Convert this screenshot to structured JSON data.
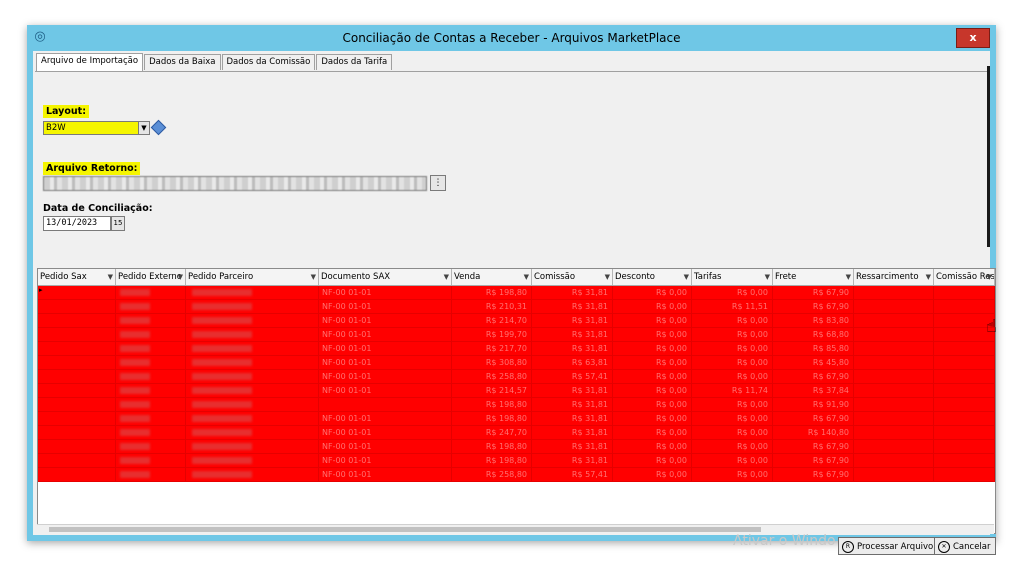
{
  "window": {
    "title": "Conciliação de Contas a Receber - Arquivos MarketPlace",
    "close_label": "x"
  },
  "tabs": [
    {
      "label": "Arquivo de Importação",
      "active": true
    },
    {
      "label": "Dados da Baixa",
      "active": false
    },
    {
      "label": "Dados da Comissão",
      "active": false
    },
    {
      "label": "Dados da Tarifa",
      "active": false
    }
  ],
  "form": {
    "layout_label": "Layout:",
    "layout_value": "B2W",
    "arquivo_label": "Arquivo Retorno:",
    "data_label": "Data de Conciliação:",
    "data_value": "13/01/2023",
    "cal_icon_text": "15"
  },
  "grid": {
    "columns": [
      {
        "label": "Pedido Sax"
      },
      {
        "label": "Pedido Externo"
      },
      {
        "label": "Pedido Parceiro"
      },
      {
        "label": "Documento SAX"
      },
      {
        "label": "Venda"
      },
      {
        "label": "Comissão"
      },
      {
        "label": "Desconto"
      },
      {
        "label": "Tarifas"
      },
      {
        "label": "Frete"
      },
      {
        "label": "Ressarcimento"
      },
      {
        "label": "Comissão Ress"
      }
    ],
    "rows": [
      {
        "documento": "NF-00    01-01",
        "venda": "R$ 198,80",
        "comissao": "R$ 31,81",
        "desconto": "R$ 0,00",
        "tarifas": "R$ 0,00",
        "frete": "R$ 67,90"
      },
      {
        "documento": "NF-00    01-01",
        "venda": "R$ 210,31",
        "comissao": "R$ 31,81",
        "desconto": "R$ 0,00",
        "tarifas": "R$ 11,51",
        "frete": "R$ 67,90"
      },
      {
        "documento": "NF-00    01-01",
        "venda": "R$ 214,70",
        "comissao": "R$ 31,81",
        "desconto": "R$ 0,00",
        "tarifas": "R$ 0,00",
        "frete": "R$ 83,80"
      },
      {
        "documento": "NF-00    01-01",
        "venda": "R$ 199,70",
        "comissao": "R$ 31,81",
        "desconto": "R$ 0,00",
        "tarifas": "R$ 0,00",
        "frete": "R$ 68,80"
      },
      {
        "documento": "NF-00    01-01",
        "venda": "R$ 217,70",
        "comissao": "R$ 31,81",
        "desconto": "R$ 0,00",
        "tarifas": "R$ 0,00",
        "frete": "R$ 85,80"
      },
      {
        "documento": "NF-00    01-01",
        "venda": "R$ 308,80",
        "comissao": "R$ 63,81",
        "desconto": "R$ 0,00",
        "tarifas": "R$ 0,00",
        "frete": "R$ 45,80"
      },
      {
        "documento": "NF-00    01-01",
        "venda": "R$ 258,80",
        "comissao": "R$ 57,41",
        "desconto": "R$ 0,00",
        "tarifas": "R$ 0,00",
        "frete": "R$ 67,90"
      },
      {
        "documento": "NF-00    01-01",
        "venda": "R$ 214,57",
        "comissao": "R$ 31,81",
        "desconto": "R$ 0,00",
        "tarifas": "R$ 11,74",
        "frete": "R$ 37,84"
      },
      {
        "documento": "",
        "venda": "R$ 198,80",
        "comissao": "R$ 31,81",
        "desconto": "R$ 0,00",
        "tarifas": "R$ 0,00",
        "frete": "R$ 91,90"
      },
      {
        "documento": "NF-00    01-01",
        "venda": "R$ 198,80",
        "comissao": "R$ 31,81",
        "desconto": "R$ 0,00",
        "tarifas": "R$ 0,00",
        "frete": "R$ 67,90"
      },
      {
        "documento": "NF-00    01-01",
        "venda": "R$ 247,70",
        "comissao": "R$ 31,81",
        "desconto": "R$ 0,00",
        "tarifas": "R$ 0,00",
        "frete": "R$ 140,80"
      },
      {
        "documento": "NF-00    01-01",
        "venda": "R$ 198,80",
        "comissao": "R$ 31,81",
        "desconto": "R$ 0,00",
        "tarifas": "R$ 0,00",
        "frete": "R$ 67,90"
      },
      {
        "documento": "NF-00    01-01",
        "venda": "R$ 198,80",
        "comissao": "R$ 31,81",
        "desconto": "R$ 0,00",
        "tarifas": "R$ 0,00",
        "frete": "R$ 67,90"
      },
      {
        "documento": "NF-00    01-01",
        "venda": "R$ 258,80",
        "comissao": "R$ 57,41",
        "desconto": "R$ 0,00",
        "tarifas": "R$ 0,00",
        "frete": "R$ 67,90"
      }
    ]
  },
  "buttons": {
    "processar": "Processar Arquivo",
    "cancelar": "Cancelar"
  },
  "watermark": "Ativar o Windo"
}
